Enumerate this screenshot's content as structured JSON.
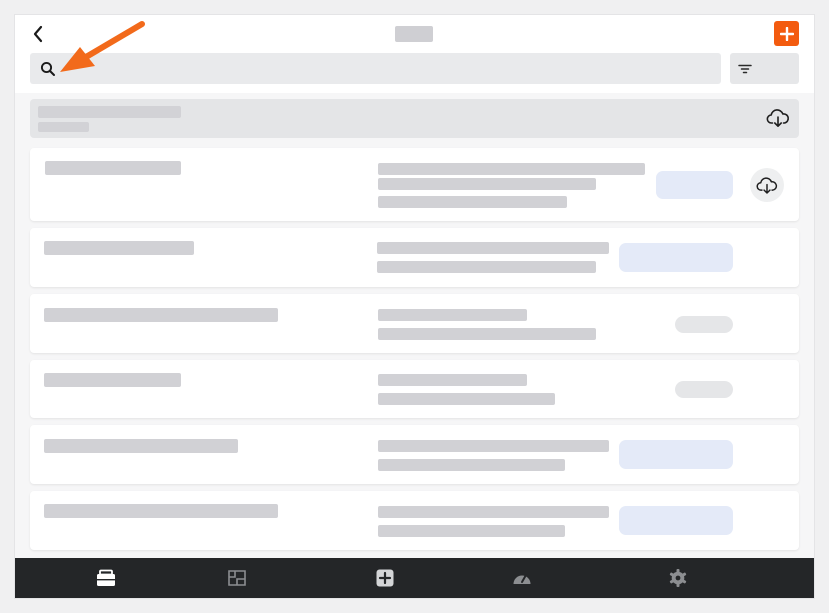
{
  "header": {
    "back_icon": "chevron-left-icon",
    "add_icon": "plus-icon",
    "accent_color": "#f35b0f"
  },
  "search": {
    "icon": "search-icon",
    "filter_icon": "filter-icon"
  },
  "section": {
    "action_icon": "cloud-download-icon"
  },
  "list": {
    "items": [
      {
        "status": "blue",
        "download": true
      },
      {
        "status": "blue",
        "download": false
      },
      {
        "status": "grey",
        "download": false
      },
      {
        "status": "grey",
        "download": false
      },
      {
        "status": "blue",
        "download": false
      },
      {
        "status": "blue",
        "download": false
      }
    ]
  },
  "tabbar": {
    "tabs": [
      {
        "icon": "briefcase-icon",
        "active": true
      },
      {
        "icon": "blueprint-icon",
        "active": false
      },
      {
        "icon": "plus-square-icon",
        "active": false
      },
      {
        "icon": "speedometer-icon",
        "active": false
      },
      {
        "icon": "gear-icon",
        "active": false
      }
    ]
  },
  "annotation": {
    "icon": "arrow-pointer-icon",
    "color": "#f26a1b"
  }
}
